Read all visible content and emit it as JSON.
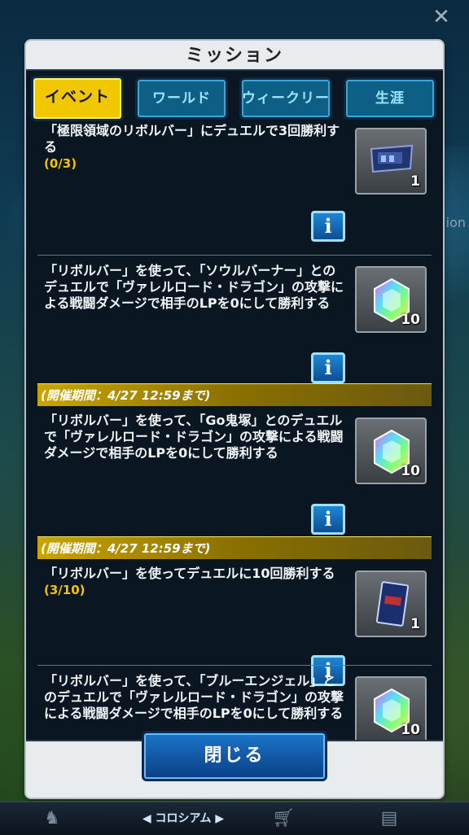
{
  "dialog": {
    "title": "ミッション",
    "tabs": [
      {
        "label": "イベント",
        "active": true
      },
      {
        "label": "ワールド",
        "active": false
      },
      {
        "label": "ウィークリー",
        "active": false
      },
      {
        "label": "生涯",
        "active": false
      }
    ],
    "missions": [
      {
        "text": "「極限領域のリボルバー」にデュエルで3回勝利する",
        "progress": "(0/3)",
        "reward_icon": "ticket-icon",
        "reward_qty": "1"
      },
      {
        "text": "「リボルバー」を使って、「ソウルバーナー」とのデュエルで「ヴァレルロード・ドラゴン」の攻撃による戦闘ダメージで相手のLPを0にして勝利する",
        "progress": "",
        "reward_icon": "gem-icon",
        "reward_qty": "10"
      },
      {
        "period": "(開催期間：4/27 12:59まで)",
        "text": "「リボルバー」を使って、「Go鬼塚」とのデュエルで「ヴァレルロード・ドラゴン」の攻撃による戦闘ダメージで相手のLPを0にして勝利する",
        "progress": "",
        "reward_icon": "gem-icon",
        "reward_qty": "10"
      },
      {
        "period": "(開催期間：4/27 12:59まで)",
        "text": "「リボルバー」を使ってデュエルに10回勝利する",
        "progress": "(3/10)",
        "reward_icon": "card-sleeve-icon",
        "reward_qty": "1"
      },
      {
        "text": "「リボルバー」を使って、「ブルーエンジェル」とのデュエルで「ヴァレルロード・ドラゴン」の攻撃による戦闘ダメージで相手のLPを0にして勝利する",
        "progress": "",
        "reward_icon": "gem-icon",
        "reward_qty": "10"
      }
    ],
    "info_label": "i",
    "close_label": "閉じる"
  },
  "background": {
    "side_text": "ion",
    "bottom_nav": {
      "center_label": "コロシアム"
    }
  },
  "colors": {
    "accent_yellow": "#f1c800",
    "tab_blue": "#0e5f86",
    "progress_yellow": "#f5c400"
  }
}
